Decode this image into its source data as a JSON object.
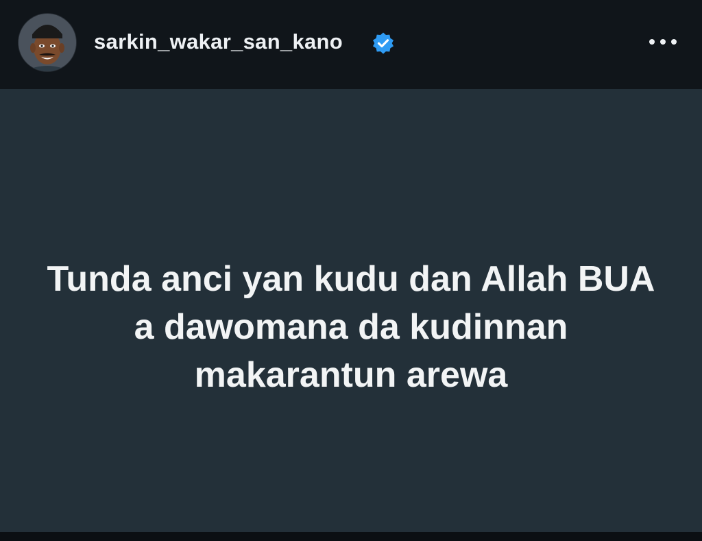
{
  "header": {
    "username": "sarkin_wakar_san_kano",
    "verified_icon": "verified-badge-icon",
    "more_icon": "more-horizontal-icon",
    "avatar": "profile-avatar"
  },
  "post": {
    "lines": [
      "Tunda anci yan kudu dan Allah BUA",
      "a dawomana da kudinnan",
      "makarantun arewa"
    ]
  },
  "colors": {
    "header_bg": "#10151a",
    "post_bg": "#233039",
    "text": "#f2f4f5",
    "verified": "#2f9bf3"
  }
}
